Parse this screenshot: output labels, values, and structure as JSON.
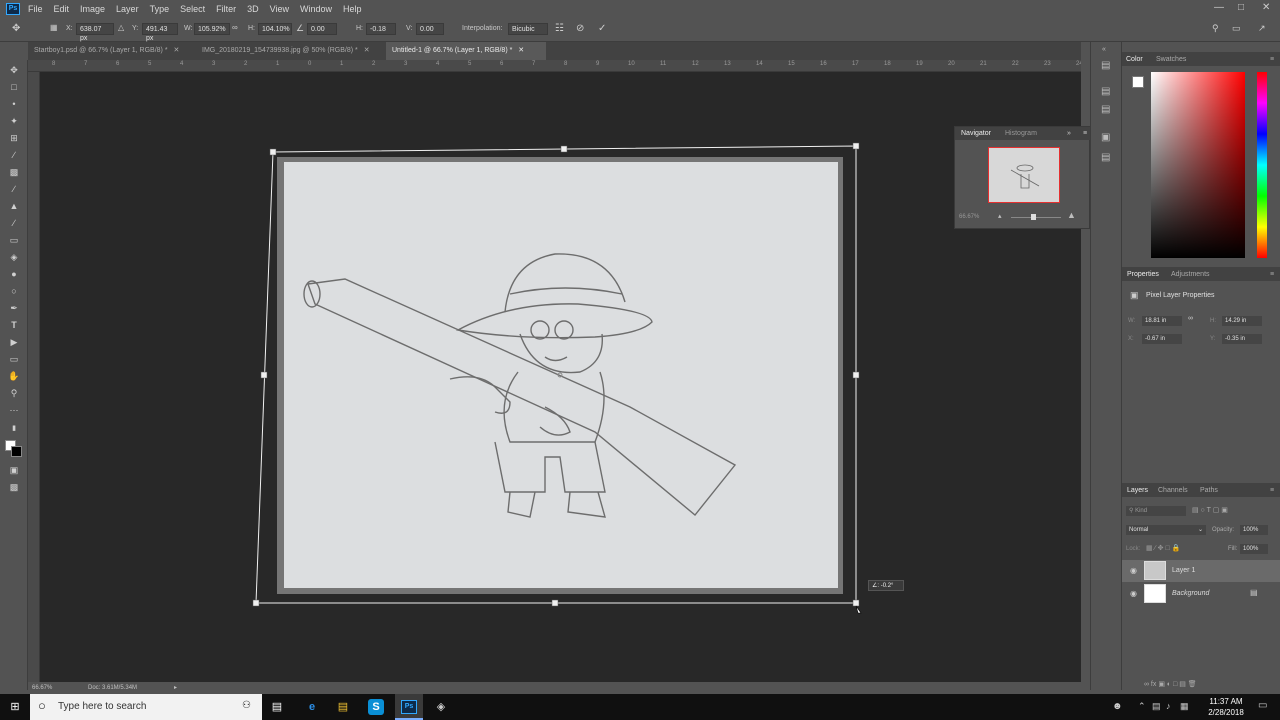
{
  "menubar": {
    "logo": "Ps",
    "items": [
      "File",
      "Edit",
      "Image",
      "Layer",
      "Type",
      "Select",
      "Filter",
      "3D",
      "View",
      "Window",
      "Help"
    ]
  },
  "options": {
    "x_label": "X:",
    "x_value": "638.07 px",
    "y_label": "Y:",
    "y_value": "491.43 px",
    "w_label": "W:",
    "w_value": "105.92%",
    "h_label": "H:",
    "h_value": "104.10%",
    "angle_value": "0.00",
    "hskew_label": "H:",
    "hskew_value": "-0.18",
    "vskew_label": "V:",
    "vskew_value": "0.00",
    "interp_label": "Interpolation:",
    "interp_value": "Bicubic"
  },
  "tabs": [
    {
      "label": "Startboy1.psd @ 66.7% (Layer 1, RGB/8) *",
      "active": false
    },
    {
      "label": "IMG_20180219_154739938.jpg @ 50% (RGB/8) *",
      "active": false
    },
    {
      "label": "Untitled-1 @ 66.7% (Layer 1, RGB/8) *",
      "active": true
    }
  ],
  "ruler_h": [
    "8",
    "7",
    "6",
    "5",
    "4",
    "3",
    "2",
    "1",
    "0",
    "1",
    "2",
    "3",
    "4",
    "5",
    "6",
    "7",
    "8",
    "9",
    "10",
    "11",
    "12",
    "13",
    "14",
    "15",
    "16",
    "17",
    "18",
    "19",
    "20",
    "21",
    "22",
    "23",
    "24"
  ],
  "rotate_tooltip": "∠: -0.2°",
  "status": {
    "zoom": "66.67%",
    "doc": "Doc: 3.61M/5.34M"
  },
  "navigator": {
    "tab_active": "Navigator",
    "tab_other": "Histogram",
    "zoom": "66.67%"
  },
  "color_panel": {
    "tab_active": "Color",
    "tab_other": "Swatches"
  },
  "properties": {
    "tab_active": "Properties",
    "tab_other": "Adjustments",
    "title": "Pixel Layer Properties",
    "w_label": "W:",
    "w_value": "18.81 in",
    "h_label": "H:",
    "h_value": "14.29 in",
    "x_label": "X:",
    "x_value": "-0.67 in",
    "y_label": "Y:",
    "y_value": "-0.35 in"
  },
  "layers_panel": {
    "tabs": [
      "Layers",
      "Channels",
      "Paths"
    ],
    "kind": "Kind",
    "blend_mode": "Normal",
    "opacity_label": "Opacity:",
    "opacity_value": "100%",
    "lock_label": "Lock:",
    "fill_label": "Fill:",
    "fill_value": "100%",
    "layers": [
      {
        "name": "Layer 1",
        "selected": true
      },
      {
        "name": "Background",
        "selected": false
      }
    ]
  },
  "taskbar": {
    "search_placeholder": "Type here to search",
    "time": "11:37 AM",
    "date": "2/28/2018"
  }
}
